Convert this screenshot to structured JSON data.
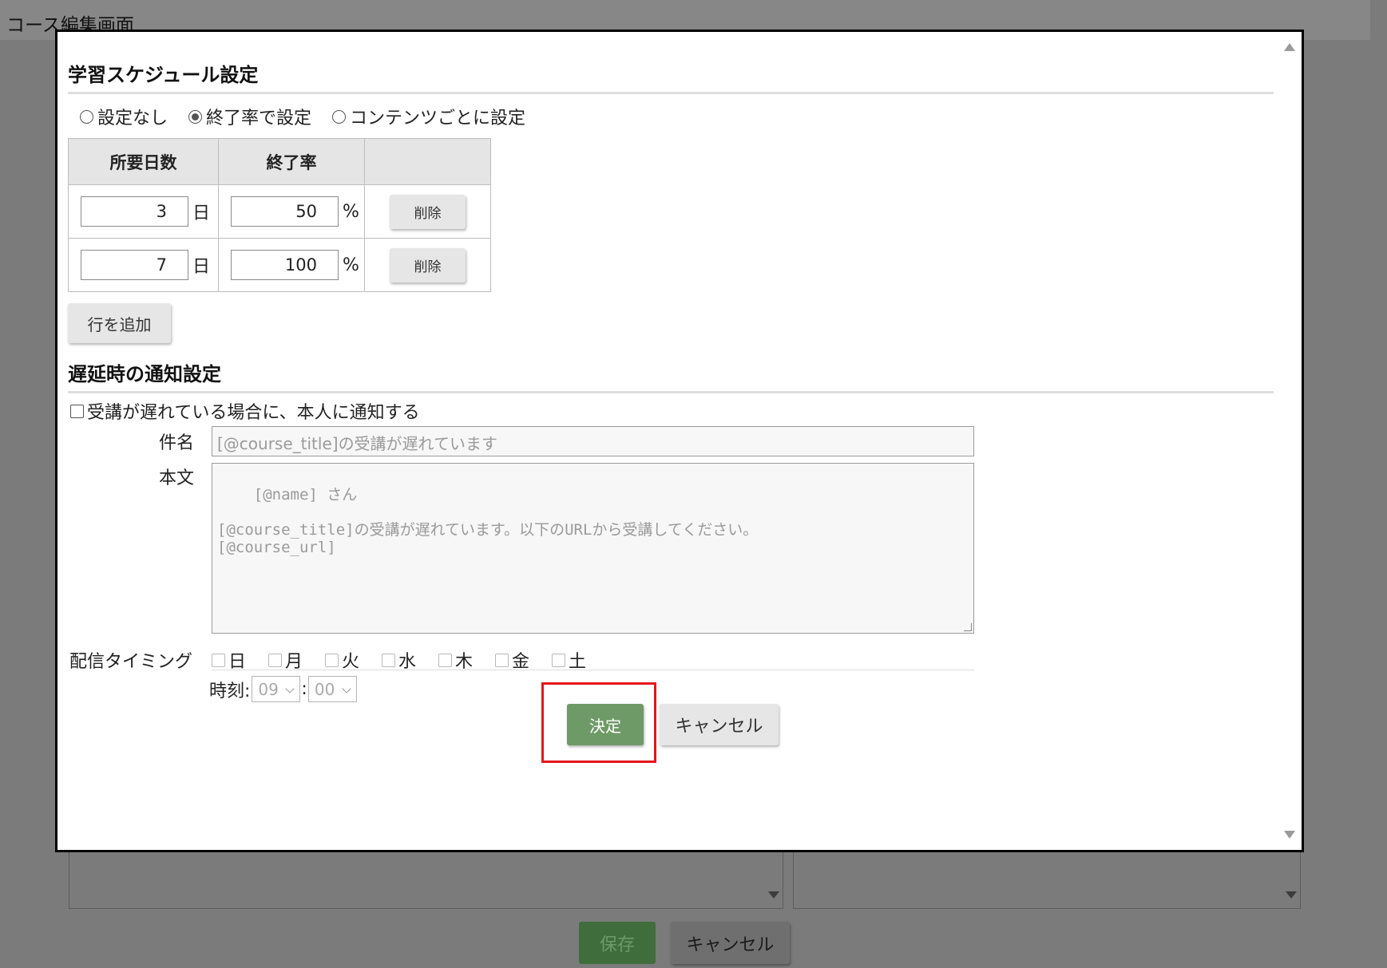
{
  "page": {
    "title": "コース編集画面"
  },
  "background": {
    "save_label": "保存",
    "cancel_label": "キャンセル"
  },
  "schedule": {
    "title": "学習スケジュール設定",
    "options": [
      {
        "label": "設定なし",
        "selected": false
      },
      {
        "label": "終了率で設定",
        "selected": true
      },
      {
        "label": "コンテンツごとに設定",
        "selected": false
      }
    ],
    "columns": [
      "所要日数",
      "終了率",
      ""
    ],
    "rows": [
      {
        "days": "3",
        "day_unit": "日",
        "rate": "50",
        "rate_unit": "%",
        "delete_label": "削除"
      },
      {
        "days": "7",
        "day_unit": "日",
        "rate": "100",
        "rate_unit": "%",
        "delete_label": "削除"
      }
    ],
    "add_row_label": "行を追加"
  },
  "notification": {
    "title": "遅延時の通知設定",
    "checkbox_label": "受講が遅れている場合に、本人に通知する",
    "subject_label": "件名",
    "subject_value": "[@course_title]の受講が遅れています",
    "body_label": "本文",
    "body_value": "[@name] さん\n\n[@course_title]の受講が遅れています。以下のURLから受講してください。\n[@course_url]",
    "timing_label": "配信タイミング",
    "days": [
      "日",
      "月",
      "火",
      "水",
      "木",
      "金",
      "土"
    ],
    "time_label": "時刻:",
    "hour": "09",
    "separator": ":",
    "minute": "00"
  },
  "dialog": {
    "ok_label": "決定",
    "cancel_label": "キャンセル",
    "highlight_color": "#e4161c",
    "ok_color": "#6e9a67"
  }
}
